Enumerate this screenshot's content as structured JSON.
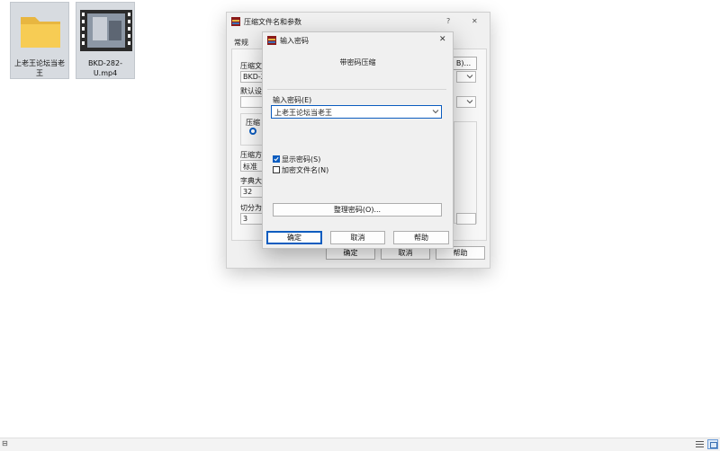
{
  "desktop": {
    "icons": [
      {
        "label": "上老王论坛当老王",
        "icon": "folder-icon"
      },
      {
        "label": "BKD-282-U.mp4",
        "icon": "video-thumbnail-icon"
      }
    ]
  },
  "back_window": {
    "title": "压缩文件名和参数",
    "help_glyph": "?",
    "close_glyph": "✕",
    "tab_general": "常规",
    "archive_name_label": "压缩文",
    "archive_name_value": "BKD-28",
    "browse_button": "B)...",
    "default_profile_label": "默认设",
    "format_group_label": "压缩",
    "method_label": "压缩方",
    "method_value": "标准",
    "dict_label": "字典大",
    "dict_value": "32",
    "split_label": "切分为",
    "split_value": "3",
    "ok_button": "确定",
    "cancel_button": "取消",
    "help_button": "帮助"
  },
  "dialog": {
    "title": "输入密码",
    "close_glyph": "✕",
    "header": "带密码压缩",
    "password_label": "输入密码(E)",
    "password_value": "上老王论坛当老王",
    "show_password_label": "显示密码(S)",
    "show_password_checked": true,
    "encrypt_names_label": "加密文件名(N)",
    "encrypt_names_checked": false,
    "organize_button": "整理密码(O)...",
    "ok_button": "确定",
    "cancel_button": "取消",
    "help_button": "帮助"
  },
  "taskbar": {
    "left_glyph": "⊟"
  },
  "colors": {
    "accent": "#0b5cbf",
    "window_bg": "#f0f0f0",
    "desktop_bg": "#ffffff"
  }
}
